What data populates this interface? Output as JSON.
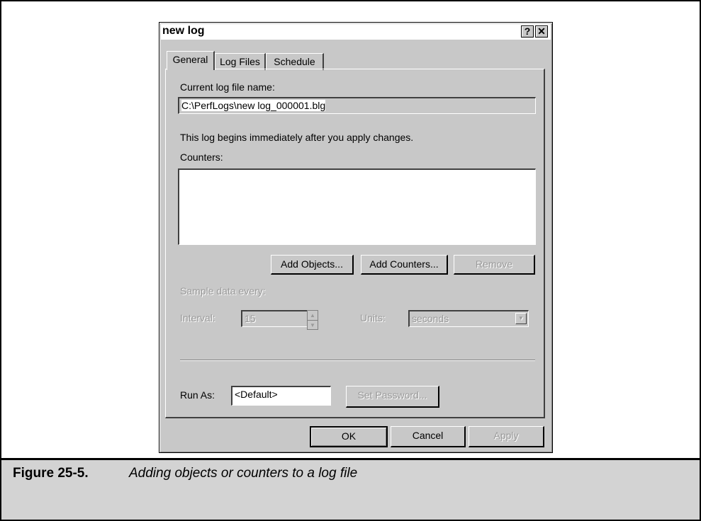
{
  "dialog": {
    "title": "new log",
    "help_btn": "?",
    "close_btn": "✕",
    "tabs": [
      {
        "label": "General"
      },
      {
        "label": "Log Files"
      },
      {
        "label": "Schedule"
      }
    ],
    "current_log_label": "Current log file name:",
    "current_log_value": "C:\\PerfLogs\\new log_000001.blg",
    "info_text": "This log begins immediately after you apply changes.",
    "counters_label": "Counters:",
    "add_objects": "Add Objects...",
    "add_counters": "Add Counters...",
    "remove": "Remove",
    "sample_label": "Sample data every:",
    "interval_label": "Interval:",
    "interval_value": "15",
    "units_label": "Units:",
    "units_value": "seconds",
    "runas_label": "Run As:",
    "runas_value": "<Default>",
    "set_password": "Set Password...",
    "ok": "OK",
    "cancel": "Cancel",
    "apply": "Apply"
  },
  "caption": {
    "number": "Figure 25-5.",
    "text": "Adding objects or counters to a log file"
  }
}
